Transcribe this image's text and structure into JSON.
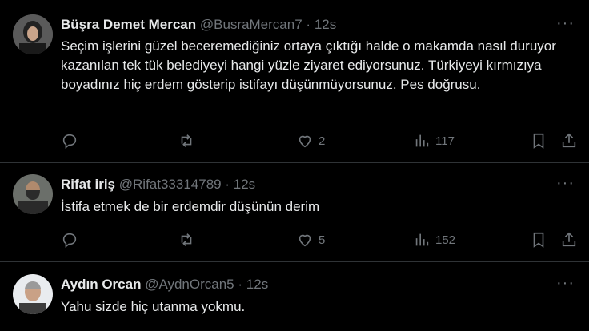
{
  "tweets": [
    {
      "name": "Büşra Demet Mercan",
      "handle": "@BusraMercan7",
      "sep": "·",
      "time": "12s",
      "text": "Seçim işlerini güzel beceremediğiniz ortaya çıktığı halde o makamda nasıl duruyor kazanılan tek tük belediyeyi hangi yüzle ziyaret ediyorsunuz. Türkiyeyi kırmızıya boyadınız hiç erdem gösterip istifayı düşünmüyorsunuz. Pes doğrusu.",
      "likes": "2",
      "views": "117"
    },
    {
      "name": "Rifat iriş",
      "handle": "@Rifat33314789",
      "sep": "·",
      "time": "12s",
      "text": "İstifa etmek de bir erdemdir düşünün derim",
      "likes": "5",
      "views": "152"
    },
    {
      "name": "Aydın Orcan",
      "handle": "@AydnOrcan5",
      "sep": "·",
      "time": "12s",
      "text": "Yahu sizde hiç utanma yokmu."
    }
  ],
  "more_glyph": "···",
  "icons": [
    "reply-icon",
    "retweet-icon",
    "like-icon",
    "views-icon",
    "bookmark-icon",
    "share-icon",
    "more-icon"
  ]
}
